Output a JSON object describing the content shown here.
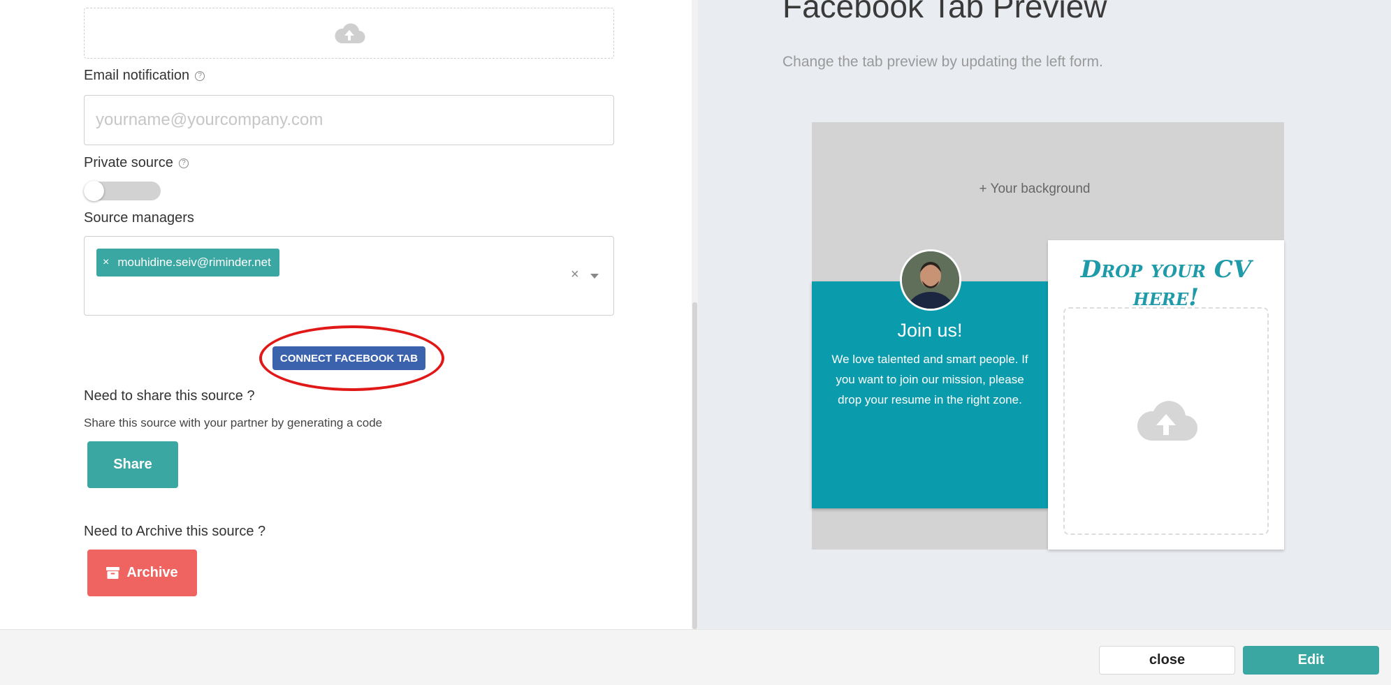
{
  "form": {
    "upload_icon": "cloud-upload-icon",
    "email": {
      "label": "Email notification",
      "help_icon": "question-circle-icon",
      "value": "",
      "placeholder": "yourname@yourcompany.com"
    },
    "private_source": {
      "label": "Private source",
      "help_icon": "question-circle-icon",
      "enabled": false
    },
    "source_managers": {
      "label": "Source managers",
      "tags": [
        {
          "remove": "×",
          "label": "mouhidine.seiv@riminder.net"
        }
      ],
      "clear_symbol": "×"
    },
    "connect_button": "CONNECT FACEBOOK TAB",
    "share_section": {
      "title": "Need to share this source ?",
      "text": "Share this source with your partner by generating a code",
      "button": "Share"
    },
    "archive_section": {
      "title": "Need to Archive this source ?",
      "button": "Archive",
      "button_icon": "archive-box-icon"
    }
  },
  "preview": {
    "title": "Facebook Tab Preview",
    "subtitle": "Change the tab preview by updating the left form.",
    "background_label": "+ Your background",
    "join_title": "Join us!",
    "join_text": "We love talented and smart people. If you want to join our mission, please drop your resume in the right zone.",
    "drop_title": "Drop your CV here!",
    "drop_icon": "cloud-upload-icon"
  },
  "footer": {
    "close": "close",
    "edit": "Edit"
  },
  "colors": {
    "teal": "#3aa7a3",
    "connect_blue": "#3b62ad",
    "archive_red": "#ef6361",
    "highlight_red": "#e11818",
    "join_card": "#0a9cad",
    "drop_title": "#1e9aa8"
  }
}
